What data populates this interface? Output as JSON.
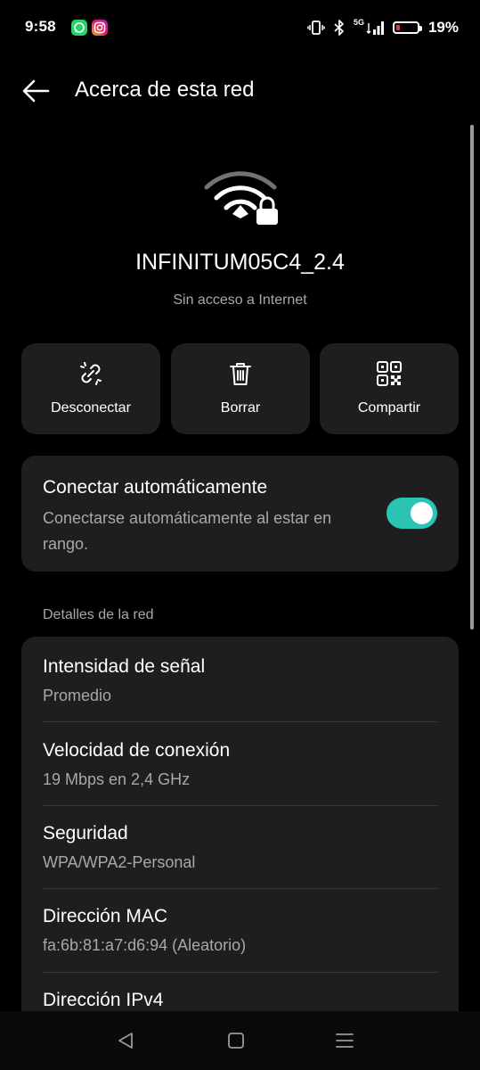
{
  "status": {
    "time": "9:58",
    "network": "5G",
    "battery_pct": "19%",
    "battery_level": 0.19
  },
  "header": {
    "title": "Acerca de esta red"
  },
  "network": {
    "name": "INFINITUM05C4_2.4",
    "status": "Sin acceso a Internet"
  },
  "actions": [
    {
      "label": "Desconectar",
      "icon": "unlink-icon"
    },
    {
      "label": "Borrar",
      "icon": "trash-icon"
    },
    {
      "label": "Compartir",
      "icon": "qr-code-icon"
    }
  ],
  "auto_connect": {
    "title": "Conectar automáticamente",
    "description": "Conectarse automáticamente al estar en rango.",
    "enabled": true,
    "accent": "#2bc4b4"
  },
  "details": {
    "section_label": "Detalles de la red",
    "rows": [
      {
        "title": "Intensidad de señal",
        "value": "Promedio"
      },
      {
        "title": "Velocidad de conexión",
        "value": "19 Mbps en 2,4 GHz"
      },
      {
        "title": "Seguridad",
        "value": "WPA/WPA2-Personal"
      },
      {
        "title": "Dirección MAC",
        "value": "fa:6b:81:a7:d6:94 (Aleatorio)"
      },
      {
        "title": "Dirección IPv4",
        "value": ""
      }
    ]
  },
  "colors": {
    "background": "#000000",
    "card": "#1e1e1e",
    "secondary_text": "#a8a8a8",
    "battery_low": "#e53935"
  }
}
